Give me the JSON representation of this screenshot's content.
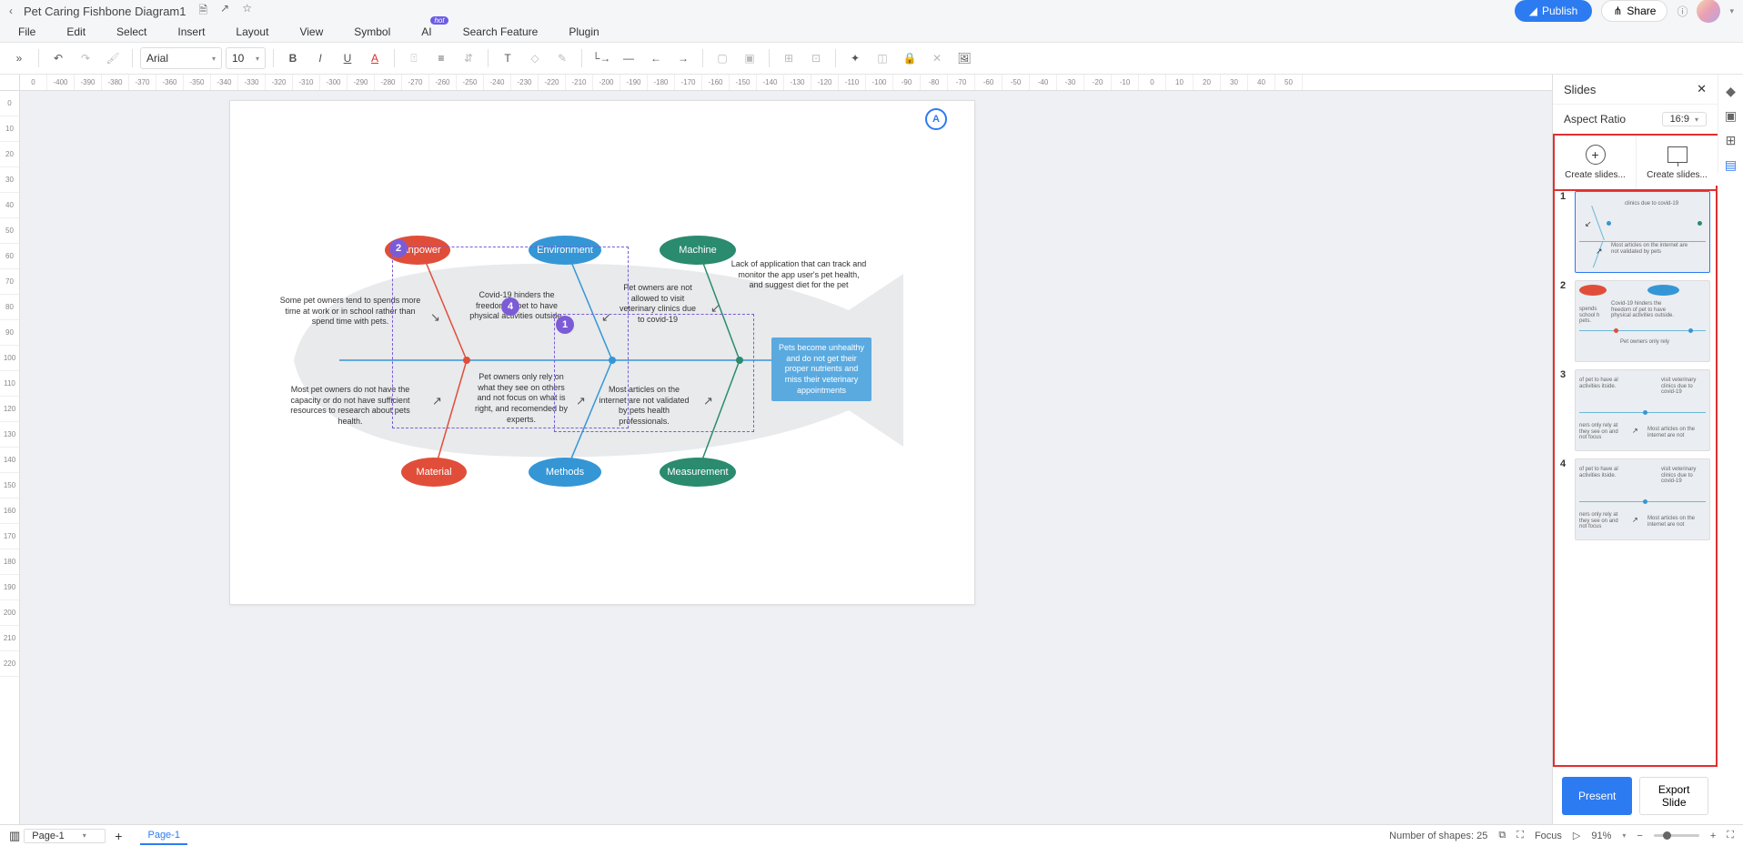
{
  "header": {
    "title": "Pet Caring Fishbone Diagram1",
    "publish": "Publish",
    "share": "Share"
  },
  "menu": {
    "file": "File",
    "edit": "Edit",
    "select": "Select",
    "insert": "Insert",
    "layout": "Layout",
    "view": "View",
    "symbol": "Symbol",
    "ai": "AI",
    "ai_badge": "hot",
    "search": "Search Feature",
    "plugin": "Plugin"
  },
  "toolbar": {
    "font": "Arial",
    "size": "10"
  },
  "ruler_h": [
    "0",
    "-400",
    "-390",
    "-380",
    "-370",
    "-360",
    "-350",
    "-340",
    "-330",
    "-320",
    "-310",
    "-300",
    "-290",
    "-280",
    "-270",
    "-260",
    "-250",
    "-240",
    "-230",
    "-220",
    "-210",
    "-200",
    "-190",
    "-180",
    "-170",
    "-160",
    "-150",
    "-140",
    "-130",
    "-120",
    "-110",
    "-100",
    "-90",
    "-80",
    "-70",
    "-60",
    "-50",
    "-40",
    "-30",
    "-20",
    "-10",
    "0",
    "10",
    "20",
    "30",
    "40",
    "50"
  ],
  "ruler_v": [
    "0",
    "10",
    "20",
    "30",
    "40",
    "50",
    "60",
    "70",
    "80",
    "90",
    "100",
    "110",
    "120",
    "130",
    "140",
    "150",
    "160",
    "170",
    "180",
    "190",
    "200",
    "210",
    "220"
  ],
  "diagram": {
    "manpower": "Manpower",
    "environment": "Environment",
    "machine": "Machine",
    "material": "Material",
    "methods": "Methods",
    "measurement": "Measurement",
    "text1": "Some pet owners tend to spends more time at work or in school rather than spend time with pets.",
    "text2": "Covid-19 hinders the freedom of pet to have physical activities outside.",
    "text3": "Pet owners are not allowed to visit veterinary clinics due to covid-19",
    "text4": "Lack of application that can track and monitor the app user's pet health, and suggest diet for the pet",
    "text5": "Most pet owners do not have the capacity or do not have sufficient resources to research about pets health.",
    "text6": "Pet owners only rely on what they see on others and not focus on what is right, and recomended by experts.",
    "text7": "Most articles on the internet are not validated by pets health professionals.",
    "result": "Pets become unhealthy and do not get their proper nutrients and miss their veterinary appointments",
    "m1": "1",
    "m2": "2",
    "m3": "4"
  },
  "panel": {
    "title": "Slides",
    "aspect_label": "Aspect Ratio",
    "aspect_value": "16:9",
    "create1": "Create slides...",
    "create2": "Create slides...",
    "present": "Present",
    "export": "Export Slide"
  },
  "slides": {
    "s1_t1": "clinics due to covid-19",
    "s1_t2": "Most articles on the internet are not validated by pets",
    "s2_t1": "spends school h pets.",
    "s2_t2": "Covid-19 hinders the freedom of pet to have physical activities outside.",
    "s2_t3": "Pet owners only rely",
    "s3_t1": "of pet to have al activities itside.",
    "s3_t2": "visit veterinary clinics due to covid-19",
    "s3_t3": "ners only rely at they see on and not focus",
    "s3_t4": "Most articles on the internet are not",
    "s4_t1": "of pet to have al activities itside.",
    "s4_t2": "visit veterinary clinics due to covid-19",
    "s4_t3": "ners only rely at they see on and not focus",
    "s4_t4": "Most articles on the internet are not"
  },
  "status": {
    "page_selector": "Page-1",
    "page_tab": "Page-1",
    "shapes": "Number of shapes: 25",
    "focus": "Focus",
    "zoom": "91%"
  }
}
